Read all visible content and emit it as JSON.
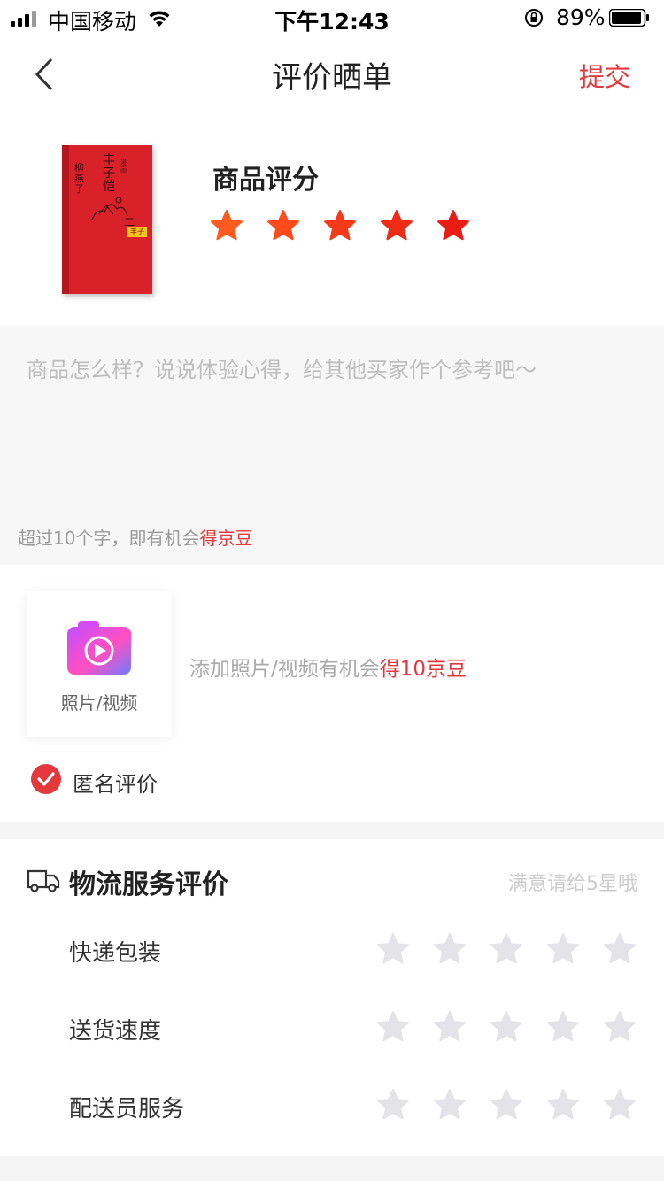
{
  "status_bar": {
    "carrier": "中国移动",
    "time": "下午12:43",
    "battery": "89%"
  },
  "nav": {
    "title": "评价晒单",
    "submit_label": "提交"
  },
  "product": {
    "rating_label": "商品评分",
    "rating": 5,
    "rating_max": 5,
    "star_colors": [
      "#ff5a1f",
      "#ff4a1c",
      "#f43a19",
      "#ee2c16",
      "#e91d13"
    ]
  },
  "review": {
    "placeholder": "商品怎么样？说说体验心得，给其他买家作个参考吧～",
    "hint_prefix": "超过10个字，即有机会",
    "hint_reward": "得京豆"
  },
  "media": {
    "upload_label": "照片/视频",
    "tip_prefix": "添加照片/视频有机会",
    "tip_reward": "得10京豆"
  },
  "anonymous": {
    "label": "匿名评价",
    "checked": true
  },
  "logistics": {
    "title": "物流服务评价",
    "hint": "满意请给5星哦",
    "rows": [
      {
        "label": "快递包装",
        "rating": 0,
        "max": 5
      },
      {
        "label": "送货速度",
        "rating": 0,
        "max": 5
      },
      {
        "label": "配送员服务",
        "rating": 0,
        "max": 5
      }
    ]
  },
  "colors": {
    "accent": "#e4393c",
    "star_empty": "#e3e3e8"
  },
  "icons": [
    "signal-icon",
    "wifi-icon",
    "rotation-lock-icon",
    "battery-icon",
    "back-chevron-icon",
    "star-icon",
    "camera-video-icon",
    "check-circle-icon",
    "truck-icon"
  ]
}
